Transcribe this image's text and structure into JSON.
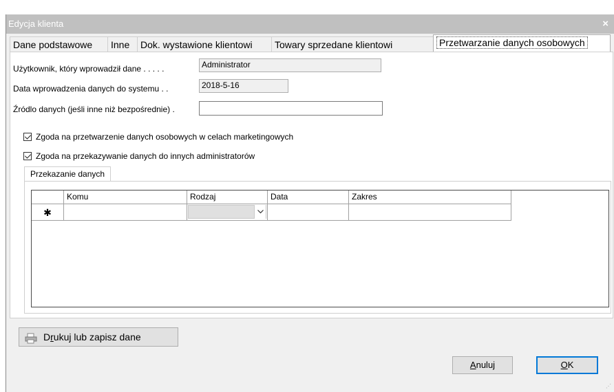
{
  "window": {
    "title": "Edycja klienta",
    "close_glyph": "×"
  },
  "tabs": [
    {
      "label": "Dane podstawowe"
    },
    {
      "label": "Inne"
    },
    {
      "label": "Dok. wystawione klientowi"
    },
    {
      "label": "Towary sprzedane klientowi"
    },
    {
      "label": "Przetwarzanie danych osobowych"
    }
  ],
  "active_tab": "Przetwarzanie danych osobowych",
  "form": {
    "user_label": "Użytkownik, który wprowadził dane . . . . .",
    "user_value": "Administrator",
    "date_label": "Data wprowadzenia danych do systemu . .",
    "date_value": "2018-5-16",
    "source_label": "Źródlo danych (jeśli inne niż bezpośrednie) .",
    "source_value": ""
  },
  "consents": [
    {
      "label": "Zgoda na przetwarzenie danych osobowych w celach marketingowych",
      "checked": true
    },
    {
      "label": "Zgoda na przekazywanie danych do innych administratorów",
      "checked": true
    }
  ],
  "transfer": {
    "tab_label": "Przekazanie danych",
    "columns": [
      "Komu",
      "Rodzaj",
      "Data",
      "Zakres"
    ],
    "new_row_marker": "✱"
  },
  "buttons": {
    "print_prefix": "D",
    "print_underlined": "r",
    "print_rest": "ukuj lub zapisz dane",
    "cancel_underlined": "A",
    "cancel_rest": "nuluj",
    "ok_underlined": "O",
    "ok_rest": "K"
  },
  "colors": {
    "titlebar": "#c0c0c0",
    "default_button_border": "#0078d7",
    "window_bg": "#f0f0f0"
  }
}
